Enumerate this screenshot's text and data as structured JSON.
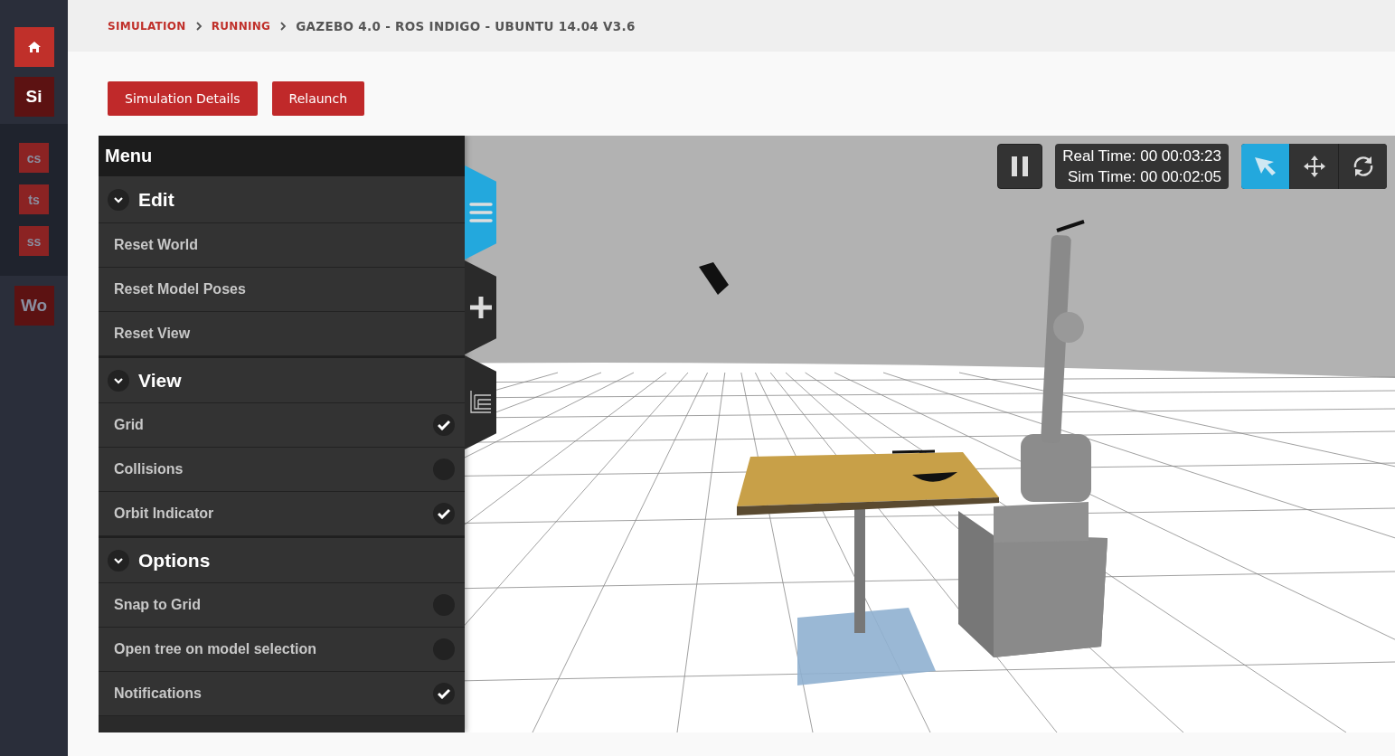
{
  "sidebar": {
    "items": [
      {
        "kind": "home",
        "selected": true
      },
      {
        "kind": "text",
        "label": "Si",
        "selected": false
      },
      {
        "kind": "text",
        "label": "cs",
        "selected": false
      },
      {
        "kind": "text",
        "label": "ts",
        "selected": false
      },
      {
        "kind": "text",
        "label": "ss",
        "selected": false
      },
      {
        "kind": "text",
        "label": "Wo",
        "selected": false
      }
    ]
  },
  "breadcrumb": [
    {
      "label": "SIMULATION",
      "link": true
    },
    {
      "label": "RUNNING",
      "link": true
    },
    {
      "label": "GAZEBO 4.0 - ROS INDIGO - UBUNTU 14.04 V3.6",
      "link": false
    }
  ],
  "buttons": [
    "Simulation Details",
    "Relaunch"
  ],
  "menu": {
    "title": "Menu",
    "sections": [
      {
        "title": "Edit",
        "expanded": true,
        "items": [
          {
            "label": "Reset World",
            "kind": "action"
          },
          {
            "label": "Reset Model Poses",
            "kind": "action"
          },
          {
            "label": "Reset View",
            "kind": "action"
          }
        ]
      },
      {
        "title": "View",
        "expanded": true,
        "items": [
          {
            "label": "Grid",
            "kind": "toggle",
            "checked": true
          },
          {
            "label": "Collisions",
            "kind": "toggle",
            "checked": false
          },
          {
            "label": "Orbit Indicator",
            "kind": "toggle",
            "checked": true
          }
        ]
      },
      {
        "title": "Options",
        "expanded": true,
        "items": [
          {
            "label": "Snap to Grid",
            "kind": "toggle",
            "checked": false
          },
          {
            "label": "Open tree on model selection",
            "kind": "toggle",
            "checked": false
          },
          {
            "label": "Notifications",
            "kind": "toggle",
            "checked": true
          }
        ]
      }
    ]
  },
  "side_tabs": [
    {
      "kind": "menu",
      "selected": true
    },
    {
      "kind": "insert",
      "selected": false
    },
    {
      "kind": "tree",
      "selected": false
    }
  ],
  "toolbar": {
    "paused": false,
    "real_time": "Real Time: 00 00:03:23",
    "sim_time": "Sim Time: 00 00:02:05",
    "modes": [
      {
        "kind": "select",
        "selected": true
      },
      {
        "kind": "translate",
        "selected": false
      },
      {
        "kind": "rotate",
        "selected": false
      }
    ]
  }
}
